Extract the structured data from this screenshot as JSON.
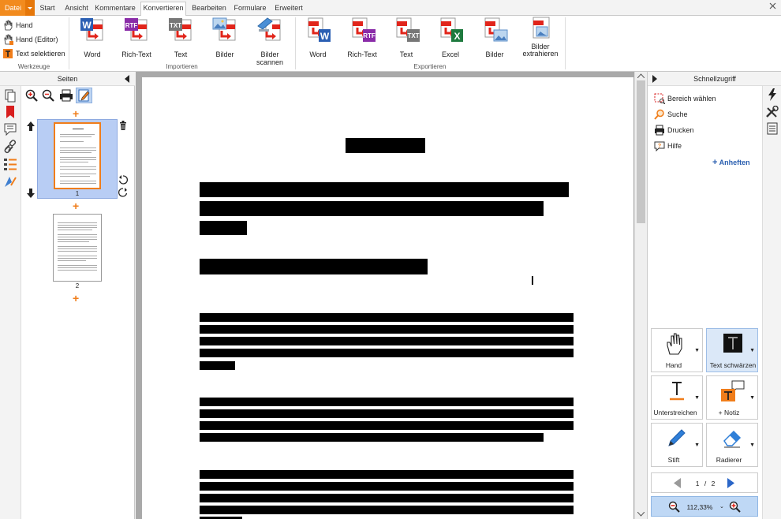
{
  "menu": {
    "tabs": [
      {
        "label": "Datei"
      },
      {
        "label": "Start"
      },
      {
        "label": "Ansicht"
      },
      {
        "label": "Kommentare"
      },
      {
        "label": "Konvertieren"
      },
      {
        "label": "Bearbeiten"
      },
      {
        "label": "Formulare"
      },
      {
        "label": "Erweitert"
      }
    ],
    "active_tab": "Konvertieren",
    "accent": "#f28b1e"
  },
  "ribbon": {
    "tools": {
      "hand": "Hand",
      "hand_editor": "Hand (Editor)",
      "select_text": "Text selektieren",
      "group_label": "Werkzeuge"
    },
    "import": {
      "group_label": "Importieren",
      "buttons": [
        {
          "label": "Word",
          "icon": "word-import-icon"
        },
        {
          "label": "Rich-Text",
          "icon": "rtf-import-icon"
        },
        {
          "label": "Text",
          "icon": "txt-import-icon"
        },
        {
          "label": "Bilder",
          "icon": "image-import-icon"
        },
        {
          "label": "Bilder scannen",
          "icon": "scan-import-icon"
        }
      ]
    },
    "export": {
      "group_label": "Exportieren",
      "buttons": [
        {
          "label": "Word",
          "icon": "word-export-icon"
        },
        {
          "label": "Rich-Text",
          "icon": "rtf-export-icon"
        },
        {
          "label": "Text",
          "icon": "txt-export-icon"
        },
        {
          "label": "Excel",
          "icon": "excel-export-icon"
        },
        {
          "label": "Bilder",
          "icon": "image-export-icon"
        },
        {
          "label": "Bilder extrahieren",
          "icon": "extract-images-icon"
        }
      ]
    },
    "format_tags": {
      "word": "W",
      "rtf": "RTF",
      "txt": "TXT",
      "pdf": "PDF",
      "excel": "X"
    }
  },
  "left_pane": {
    "title": "Seiten",
    "pages": [
      {
        "label": "1"
      },
      {
        "label": "2"
      }
    ]
  },
  "right_pane": {
    "title": "Schnellzugriff",
    "quick_items": [
      {
        "label": "Bereich wählen"
      },
      {
        "label": "Suche"
      },
      {
        "label": "Drucken"
      },
      {
        "label": "Hilfe"
      }
    ],
    "pin_label": "Anheften",
    "tool_buttons": [
      {
        "label": "Hand"
      },
      {
        "label": "Text schwärzen"
      },
      {
        "label": "Unterstreichen"
      },
      {
        "label": "+ Notiz"
      },
      {
        "label": "Stift"
      },
      {
        "label": "Radierer"
      }
    ],
    "page_current": "1",
    "page_sep": "/",
    "page_total": "2",
    "zoom": "112,33%"
  }
}
